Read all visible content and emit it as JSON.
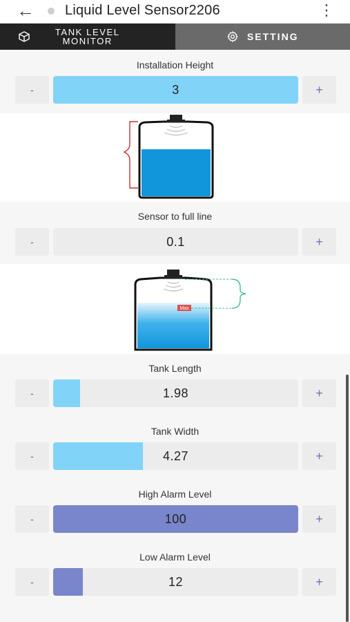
{
  "app": {
    "title": "Liquid Level Sensor2206"
  },
  "icons": {
    "back": "arrow-left-icon",
    "more": "more-vert-icon",
    "tank": "cube-icon",
    "settings": "gear-icon"
  },
  "tabs": [
    {
      "label": "TANK LEVEL MONITOR"
    },
    {
      "label": "SETTING"
    }
  ],
  "colors": {
    "blue_fill": "#81d3f8",
    "purple_fill": "#7986cb",
    "tank_water": "#1296db"
  },
  "fields": {
    "installation_height": {
      "label": "Installation Height",
      "value": "3",
      "fill_fraction": 1.0,
      "minus": "-",
      "plus": "+"
    },
    "sensor_to_full_line": {
      "label": "Sensor to full line",
      "value": "0.1",
      "fill_fraction": 0.0,
      "minus": "-",
      "plus": "+"
    },
    "tank_length": {
      "label": "Tank Length",
      "value": "1.98",
      "fill_fraction": 0.11,
      "minus": "-",
      "plus": "+"
    },
    "tank_width": {
      "label": "Tank Width",
      "value": "4.27",
      "fill_fraction": 0.365,
      "minus": "-",
      "plus": "+"
    },
    "high_alarm_level": {
      "label": "High Alarm Level",
      "value": "100",
      "fill_fraction": 1.0,
      "minus": "-",
      "plus": "+"
    },
    "low_alarm_level": {
      "label": "Low Alarm Level",
      "value": "12",
      "fill_fraction": 0.12,
      "minus": "-",
      "plus": "+"
    }
  },
  "diagram2": {
    "max_label": "Max"
  }
}
